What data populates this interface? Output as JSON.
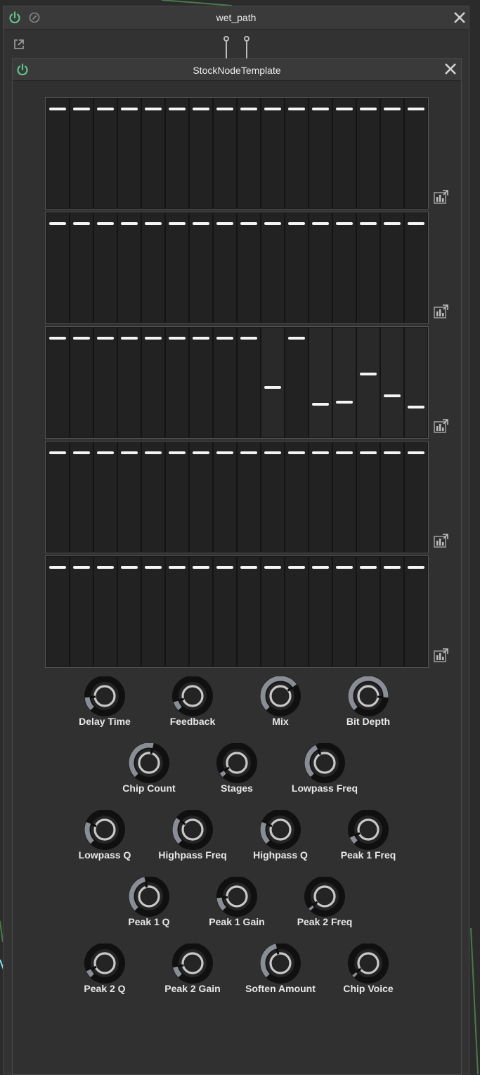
{
  "outer_window": {
    "title": "wet_path"
  },
  "inner_window": {
    "title": "StockNodeTemplate"
  },
  "slider_banks": [
    {
      "values": [
        0.93,
        0.93,
        0.93,
        0.93,
        0.93,
        0.93,
        0.93,
        0.93,
        0.93,
        0.93,
        0.93,
        0.93,
        0.93,
        0.93,
        0.93,
        0.93
      ]
    },
    {
      "values": [
        0.93,
        0.93,
        0.93,
        0.93,
        0.93,
        0.93,
        0.93,
        0.93,
        0.93,
        0.93,
        0.93,
        0.93,
        0.93,
        0.93,
        0.93,
        0.93
      ]
    },
    {
      "values": [
        0.93,
        0.93,
        0.93,
        0.93,
        0.93,
        0.93,
        0.93,
        0.93,
        0.93,
        0.45,
        0.93,
        0.29,
        0.31,
        0.58,
        0.37,
        0.26
      ]
    },
    {
      "values": [
        0.93,
        0.93,
        0.93,
        0.93,
        0.93,
        0.93,
        0.93,
        0.93,
        0.93,
        0.93,
        0.93,
        0.93,
        0.93,
        0.93,
        0.93,
        0.93
      ]
    },
    {
      "values": [
        0.93,
        0.93,
        0.93,
        0.93,
        0.93,
        0.93,
        0.93,
        0.93,
        0.93,
        0.93,
        0.93,
        0.93,
        0.93,
        0.93,
        0.93,
        0.93
      ]
    }
  ],
  "knob_rows": [
    [
      {
        "label": "Delay Time",
        "value": 0.15
      },
      {
        "label": "Feedback",
        "value": 0.1
      },
      {
        "label": "Mix",
        "value": 0.7
      },
      {
        "label": "Bit Depth",
        "value": 0.85
      }
    ],
    [
      {
        "label": "Chip Count",
        "value": 0.55
      },
      {
        "label": "Stages",
        "value": 0.05
      },
      {
        "label": "Lowpass Freq",
        "value": 0.4
      }
    ],
    [
      {
        "label": "Lowpass Q",
        "value": 0.25
      },
      {
        "label": "Highpass Freq",
        "value": 0.3
      },
      {
        "label": "Highpass Q",
        "value": 0.25
      },
      {
        "label": "Peak 1 Freq",
        "value": 0.08
      }
    ],
    [
      {
        "label": "Peak 1 Q",
        "value": 0.45
      },
      {
        "label": "Peak 1 Gain",
        "value": 0.15
      },
      {
        "label": "Peak 2 Freq",
        "value": 0.03
      }
    ],
    [
      {
        "label": "Peak 2 Q",
        "value": 0.08
      },
      {
        "label": "Peak 2 Gain",
        "value": 0.12
      },
      {
        "label": "Soften Amount",
        "value": 0.45
      },
      {
        "label": "Chip Voice",
        "value": 0.03
      }
    ]
  ],
  "colors": {
    "power": "#5fc48a",
    "arc_active": "#8a8d96",
    "arc_track": "#101010",
    "knob_face": "#242424",
    "knob_ring": "#c8c8c8",
    "handle": "#f5f5f5",
    "cable": "#7fe6f0"
  },
  "icons": {
    "power": "power-icon",
    "bypass": "bypass-icon",
    "close": "close-icon",
    "popout": "popout-icon",
    "bank_edit": "table-edit-icon"
  }
}
